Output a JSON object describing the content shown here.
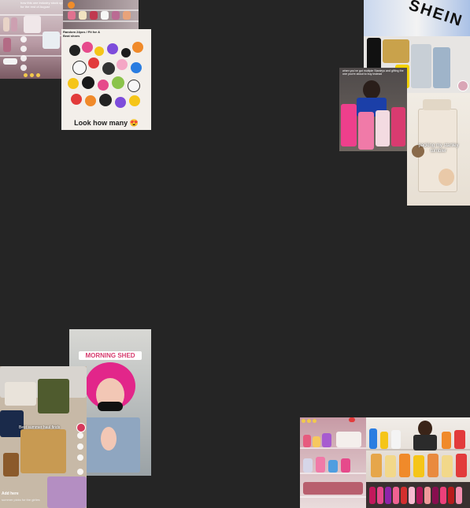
{
  "tiles": {
    "top_left_fridge": {
      "caption": "how this one industry stock up for the rest of August",
      "icon_rail": [
        "heart-icon",
        "comment-icon",
        "bookmark-icon",
        "share-icon"
      ]
    },
    "top_left_fragrance": {},
    "jibbitz": {
      "header": "Random 24pcs / Fit for & Beat shoes",
      "footer": "Look how many 😍"
    },
    "shein_haul": {
      "bag_text": "SHEIN"
    },
    "stanley_pink": {
      "caption": "when you've got multiple Stanleys and gifting the one you're about to buy instead"
    },
    "stanley_packing": {
      "caption": "packing my stanley tumbler"
    },
    "morning_shed": {
      "label": "MORNING SHED",
      "icon_rail": [
        "heart-icon",
        "comment-icon",
        "bookmark-icon",
        "share-icon"
      ]
    },
    "shoe_closet": {
      "caption": "Best summer haul finds",
      "footer": "Add here",
      "subfooter": "summer picks for the girlies"
    },
    "beauty_shelves": {},
    "haircare_shelves": {},
    "nail_polish": {}
  },
  "colors": {
    "background": "#252525",
    "pink_accent": "#e64a8b",
    "stanley_pink": "#f07aa8",
    "stanley_cream": "#efe6da"
  }
}
